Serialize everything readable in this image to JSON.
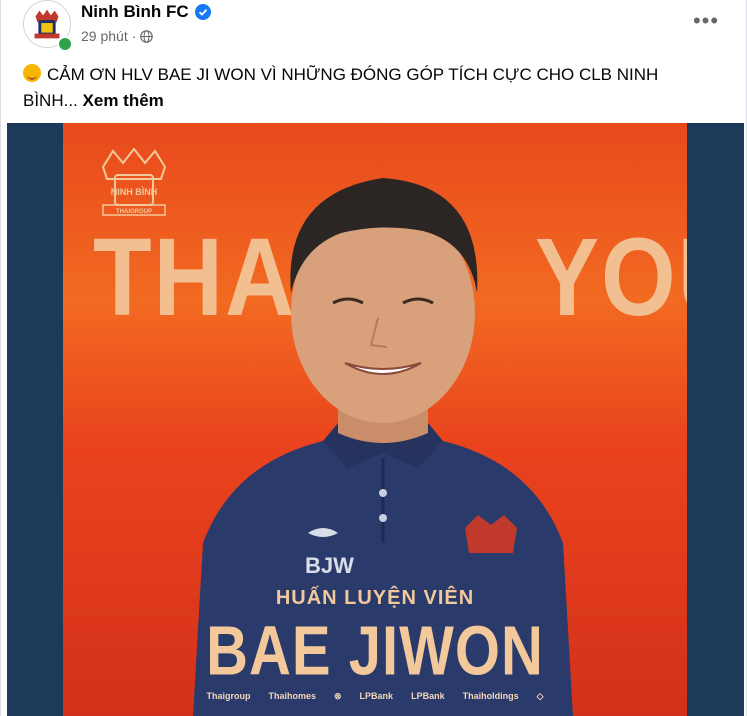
{
  "post": {
    "page_name": "Ninh Bình FC",
    "time_ago": "29 phút",
    "separator": "·",
    "more_label": "•••",
    "text": "CẢM ƠN HLV BAE JI WON VÌ NHỮNG ĐÓNG GÓP TÍCH CỰC CHO CLB NINH BÌNH...",
    "see_more": "Xem thêm"
  },
  "poster": {
    "thank": "THANK",
    "you": "YOU",
    "role": "HUẤN LUYỆN VIÊN",
    "name": "BAE JIWON",
    "shirt_initials": "BJW",
    "logo_text": "NINH BÌNH",
    "logo_sub": "THAIGROUP",
    "sponsors": [
      "Thaigroup",
      "Thaihomes",
      "⊗",
      "LPBank",
      "LPBank",
      "Thaiholdings",
      "◇"
    ]
  },
  "colors": {
    "accent": "#1877f2",
    "poster_orange": "#e8491c",
    "poster_text": "#f3c89a",
    "media_bg": "#1e3a5a",
    "online": "#31a24c"
  }
}
